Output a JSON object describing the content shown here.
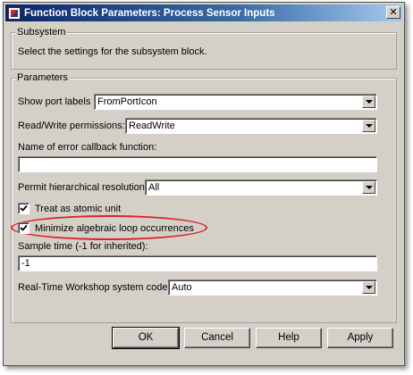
{
  "window": {
    "title": "Function Block Parameters: Process Sensor Inputs",
    "close_glyph": "✕"
  },
  "subsystem": {
    "legend": "Subsystem",
    "description": "Select the settings for the subsystem block."
  },
  "parameters": {
    "legend": "Parameters",
    "show_port_labels": {
      "label": "Show port labels",
      "value": "FromPortIcon"
    },
    "read_write": {
      "label": "Read/Write permissions:",
      "value": "ReadWrite"
    },
    "error_callback": {
      "label": "Name of error callback function:",
      "value": ""
    },
    "hierarchical": {
      "label": "Permit hierarchical resolution:",
      "value": "All"
    },
    "atomic": {
      "label": "Treat as atomic unit",
      "checked": true
    },
    "minimize_loop": {
      "label": "Minimize algebraic loop occurrences",
      "checked": true
    },
    "sample_time": {
      "label": "Sample time (-1 for inherited):",
      "value": "-1"
    },
    "rtw_code": {
      "label": "Real-Time Workshop system code:",
      "value": "Auto"
    }
  },
  "buttons": {
    "ok": "OK",
    "cancel": "Cancel",
    "help": "Help",
    "apply": "Apply"
  },
  "colors": {
    "title_bar": "#0a246a",
    "dialog_bg": "#d4d0c8",
    "highlight": "#e0202a"
  }
}
